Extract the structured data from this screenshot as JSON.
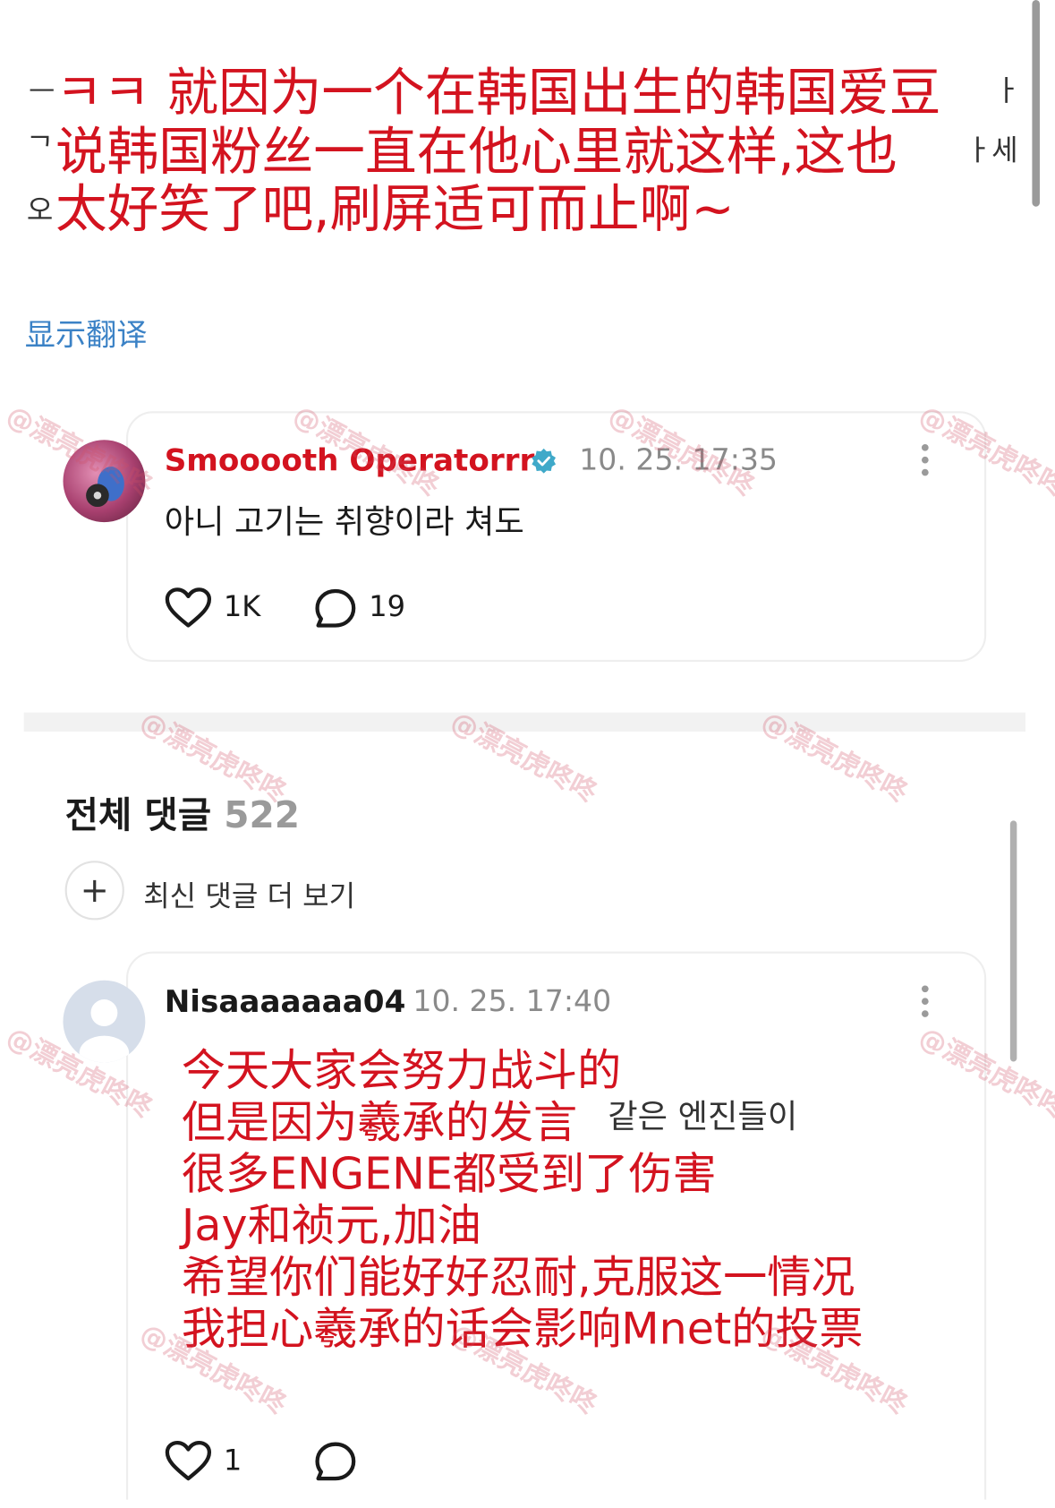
{
  "post_overlay": {
    "line1": "ㅋㅋ 就因为一个在韩国出生的韩国爱豆",
    "line2": "说韩国粉丝一直在他心里就这样,这也",
    "line3": "太好笑了吧,刷屏适可而止啊~"
  },
  "edge_glyphs": {
    "left1": "ᅳ",
    "left2": "ᄀ",
    "left3": "오",
    "right1": "ㅏ",
    "right2": "ㅏ세"
  },
  "translate_link": "显示翻译",
  "reply": {
    "author": "Smooooth Operatorrrr",
    "timestamp": "10. 25. 17:35",
    "text": "아니 고기는 취향이라 쳐도",
    "likes": "1K",
    "comments": "19"
  },
  "comments_section": {
    "title": "전체 댓글",
    "count": "522",
    "more_label": "최신 댓글 더 보기"
  },
  "comment": {
    "author": "Nisaaaaaaa04",
    "timestamp": "10. 25. 17:40",
    "visible_korean": "같은 엔진들이",
    "likes": "1",
    "translation_lines": [
      "今天大家会努力战斗的",
      "但是因为羲承的发言",
      "很多ENGENE都受到了伤害",
      "Jay和祯元,加油",
      "希望你们能好好忍耐,克服这一情况",
      "我担心羲承的话会影响Mnet的投票"
    ]
  },
  "watermark_text": "@漂亮虎咚咚",
  "colors": {
    "overlay_red": "#d3131f",
    "link_blue": "#3b82c6",
    "verified_teal": "#3fa9c9",
    "watermark": "#d25064"
  },
  "icons": {
    "like": "heart-icon",
    "comment": "comment-bubble-icon",
    "more": "more-dots-icon",
    "verified": "verified-badge-icon",
    "add": "plus-icon"
  }
}
